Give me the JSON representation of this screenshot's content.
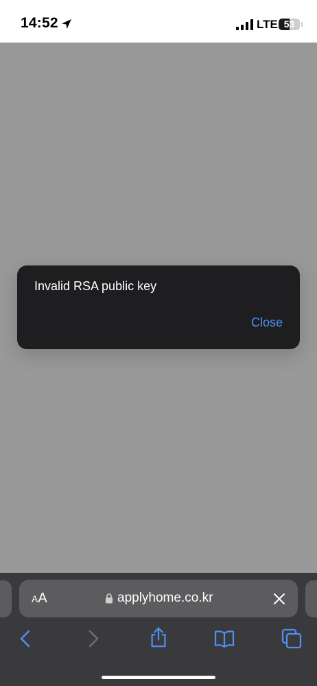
{
  "status_bar": {
    "time": "14:52",
    "network": "LTE",
    "battery_level": "53",
    "battery_fraction": 0.53
  },
  "dialog": {
    "message": "Invalid RSA public key",
    "close_label": "Close",
    "accent_color": "#4d8ff5"
  },
  "browser": {
    "text_size_small": "A",
    "text_size_large": "A",
    "url": "applyhome.co.kr",
    "icons": [
      "location-arrow-icon",
      "signal-icon",
      "lock-icon",
      "clear-icon",
      "back-icon",
      "forward-icon",
      "share-icon",
      "bookmarks-icon",
      "tabs-icon"
    ]
  }
}
